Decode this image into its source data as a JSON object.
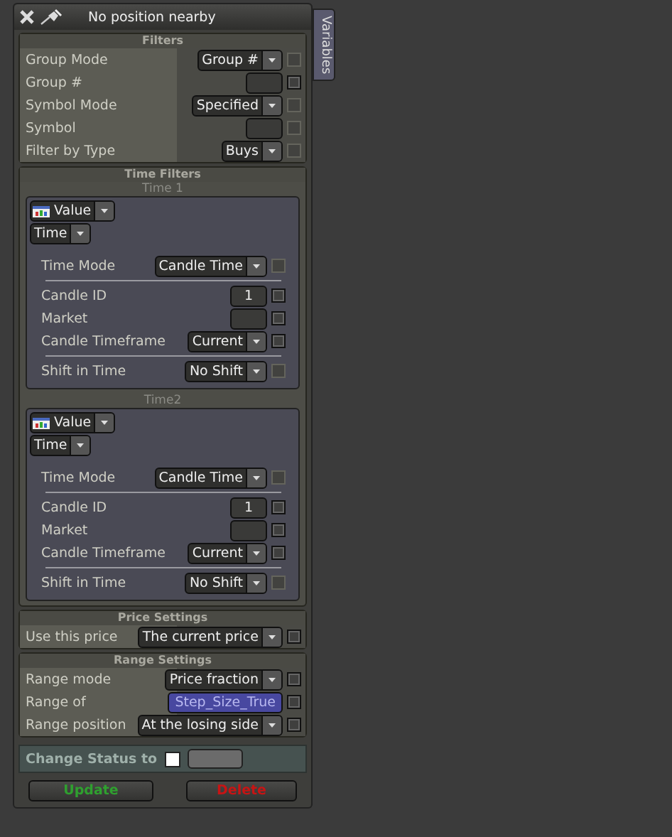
{
  "window": {
    "title": "No position nearby",
    "side_tab": "Variables"
  },
  "filters": {
    "title": "Filters",
    "rows": [
      {
        "kind": "dropdown",
        "label": "Group Mode",
        "value": "Group #",
        "checkbox_disabled": true
      },
      {
        "kind": "input",
        "label": "Group #",
        "checkbox_disabled": false
      },
      {
        "kind": "dropdown",
        "label": "Symbol Mode",
        "value": "Specified",
        "checkbox_disabled": true
      },
      {
        "kind": "input",
        "label": "Symbol",
        "checkbox_disabled": true
      },
      {
        "kind": "dropdown",
        "label": "Filter by Type",
        "value": "Buys",
        "checkbox_disabled": true
      }
    ]
  },
  "time_filters": {
    "title": "Time Filters",
    "blocks": [
      {
        "title": "Time 1",
        "source": "Value",
        "type": "Time",
        "rows": [
          {
            "kind": "dropdown",
            "label": "Time Mode",
            "value": "Candle Time",
            "checkbox_disabled": true
          },
          {
            "kind": "separator"
          },
          {
            "kind": "input",
            "label": "Candle ID",
            "value": "1",
            "checkbox_disabled": false
          },
          {
            "kind": "input",
            "label": "Market",
            "checkbox_disabled": false
          },
          {
            "kind": "dropdown",
            "label": "Candle Timeframe",
            "value": "Current",
            "checkbox_disabled": false
          },
          {
            "kind": "separator"
          },
          {
            "kind": "dropdown",
            "label": "Shift in Time",
            "value": "No Shift",
            "checkbox_disabled": true
          }
        ]
      },
      {
        "title": "Time2",
        "source": "Value",
        "type": "Time",
        "rows": [
          {
            "kind": "dropdown",
            "label": "Time Mode",
            "value": "Candle Time",
            "checkbox_disabled": true
          },
          {
            "kind": "separator"
          },
          {
            "kind": "input",
            "label": "Candle ID",
            "value": "1",
            "checkbox_disabled": false
          },
          {
            "kind": "input",
            "label": "Market",
            "checkbox_disabled": false
          },
          {
            "kind": "dropdown",
            "label": "Candle Timeframe",
            "value": "Current",
            "checkbox_disabled": false
          },
          {
            "kind": "separator"
          },
          {
            "kind": "dropdown",
            "label": "Shift in Time",
            "value": "No Shift",
            "checkbox_disabled": true
          }
        ]
      }
    ]
  },
  "price_settings": {
    "title": "Price Settings",
    "rows": [
      {
        "kind": "dropdown",
        "label": "Use this price",
        "value": "The current price",
        "checkbox_disabled": false
      }
    ]
  },
  "range_settings": {
    "title": "Range Settings",
    "rows": [
      {
        "kind": "dropdown",
        "label": "Range mode",
        "value": "Price fraction",
        "checkbox_disabled": false
      },
      {
        "kind": "variable",
        "label": "Range of",
        "value": "Step_Size_True",
        "checkbox_disabled": false
      },
      {
        "kind": "dropdown",
        "label": "Range position",
        "value": "At the losing side",
        "checkbox_disabled": false
      }
    ]
  },
  "change_status": {
    "label": "Change Status to",
    "checked": false
  },
  "buttons": [
    {
      "label": "Update",
      "color": "#2fa02f"
    },
    {
      "label": "Delete",
      "color": "#c81414"
    }
  ]
}
